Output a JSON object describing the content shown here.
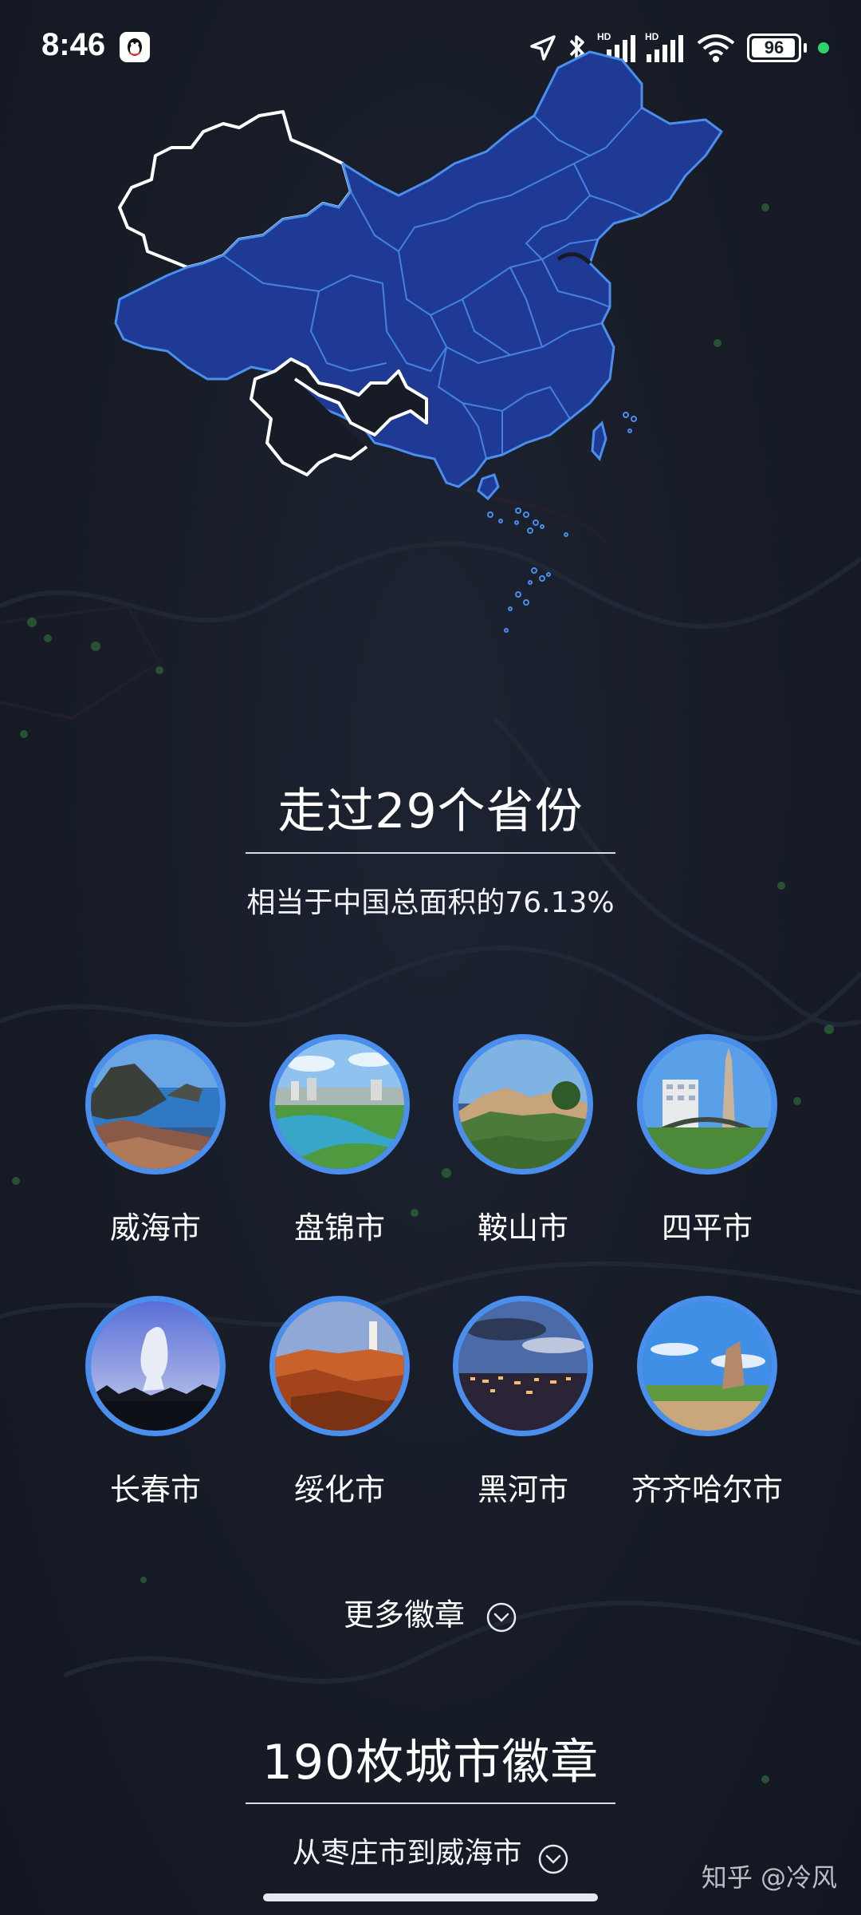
{
  "status_bar": {
    "time": "8:46",
    "battery": "96",
    "battery_level": 0.96,
    "icons": [
      "qq-icon",
      "location-icon",
      "bluetooth-icon",
      "hd-signal-icon",
      "hd-signal-icon",
      "wifi-icon",
      "battery-icon",
      "privacy-dot-icon"
    ]
  },
  "map": {
    "visited_color": "#1e3a94",
    "visited_border": "#4a8fee",
    "unvisited_border": "#ffffff"
  },
  "provinces": {
    "title": "走过29个省份",
    "subtitle": "相当于中国总面积的76.13%"
  },
  "badges": [
    {
      "name": "威海市",
      "scene": "coast-rocks"
    },
    {
      "name": "盘锦市",
      "scene": "river-city"
    },
    {
      "name": "鞍山市",
      "scene": "mountain"
    },
    {
      "name": "四平市",
      "scene": "monument"
    },
    {
      "name": "长春市",
      "scene": "sculpture"
    },
    {
      "name": "绥化市",
      "scene": "red-cliff"
    },
    {
      "name": "黑河市",
      "scene": "night-city"
    },
    {
      "name": "齐齐哈尔市",
      "scene": "grassland-stone"
    }
  ],
  "more_badges": {
    "label": "更多徽章",
    "icon": "chevron-down-icon"
  },
  "city_badges": {
    "title": "190枚城市徽章",
    "subtitle": "从枣庄市到威海市"
  },
  "watermark": "知乎 @冷风",
  "colors": {
    "background": "#161b26",
    "accent": "#4a8fee",
    "text": "#ffffff"
  }
}
